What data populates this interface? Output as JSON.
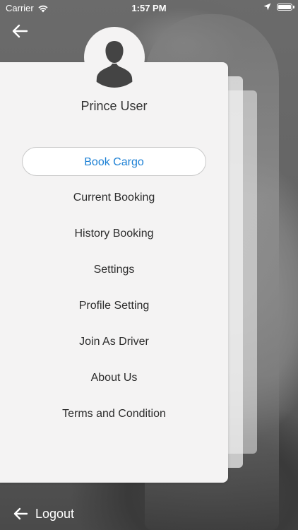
{
  "status_bar": {
    "carrier": "Carrier",
    "time": "1:57 PM"
  },
  "icons": {
    "back": "arrow-left-icon",
    "avatar": "user-silhouette-icon",
    "logout": "arrow-left-icon"
  },
  "profile": {
    "name": "Prince User"
  },
  "menu": {
    "items": [
      {
        "label": "Book Cargo",
        "active": true
      },
      {
        "label": "Current Booking"
      },
      {
        "label": "History Booking"
      },
      {
        "label": "Settings"
      },
      {
        "label": "Profile Setting"
      },
      {
        "label": "Join As Driver"
      },
      {
        "label": "About Us"
      },
      {
        "label": "Terms and Condition"
      }
    ]
  },
  "footer": {
    "logout_label": "Logout"
  },
  "colors": {
    "accent": "#1a7fd4",
    "panel": "#f4f3f3",
    "text": "#2d2d2d"
  }
}
